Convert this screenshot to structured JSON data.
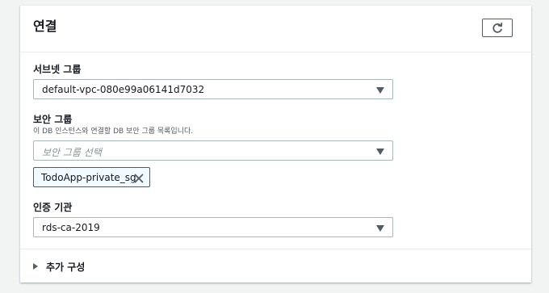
{
  "panel": {
    "title": "연결",
    "refresh_icon": "refresh-icon"
  },
  "subnet_group": {
    "label": "서브넷 그룹",
    "value": "default-vpc-080e99a06141d7032"
  },
  "security_group": {
    "label": "보안 그룹",
    "description": "이 DB 인스턴스와 연결할 DB 보안 그룹 목록입니다.",
    "placeholder": "보안 그룹 선택",
    "selected_token": "TodoApp-private_sg"
  },
  "certificate_authority": {
    "label": "인증 기관",
    "value": "rds-ca-2019"
  },
  "additional_config": {
    "label": "추가 구성"
  },
  "colors": {
    "token_border": "#0073bb",
    "token_bg": "#f1faff",
    "text": "#16191f"
  }
}
